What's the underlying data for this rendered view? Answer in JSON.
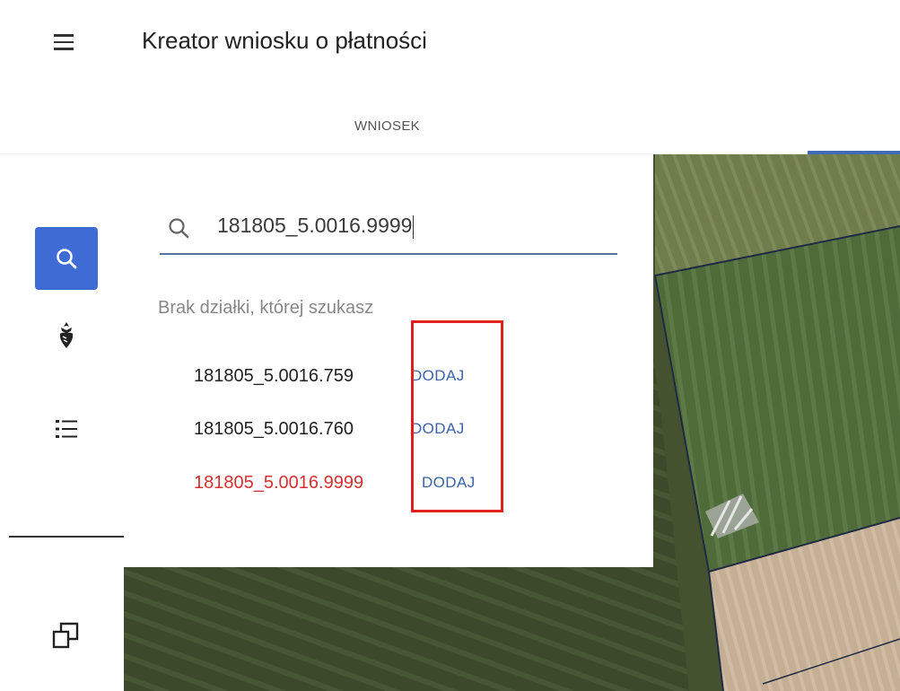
{
  "header": {
    "title": "Kreator wniosku o płatności",
    "menu_icon": "menu-icon"
  },
  "tabs": [
    {
      "label": "WNIOSEK"
    }
  ],
  "rail": {
    "items": [
      {
        "icon": "search-icon",
        "active": true
      },
      {
        "icon": "crop-icon",
        "active": false
      },
      {
        "icon": "list-icon",
        "active": false
      },
      {
        "icon": "layers-icon",
        "active": false
      }
    ]
  },
  "search": {
    "value": "181805_5.0016.9999",
    "not_found_text": "Brak działki, której szukasz"
  },
  "results": [
    {
      "parcel": "181805_5.0016.759",
      "action": "DODAJ"
    },
    {
      "parcel": "181805_5.0016.760",
      "action": "DODAJ"
    },
    {
      "parcel": "181805_5.0016.9999",
      "action": "DODAJ",
      "highlighted": true
    }
  ],
  "colors": {
    "accent": "#3f6cd4",
    "link": "#3b63a7",
    "error": "#d53030",
    "annotation": "#e01f1f"
  }
}
